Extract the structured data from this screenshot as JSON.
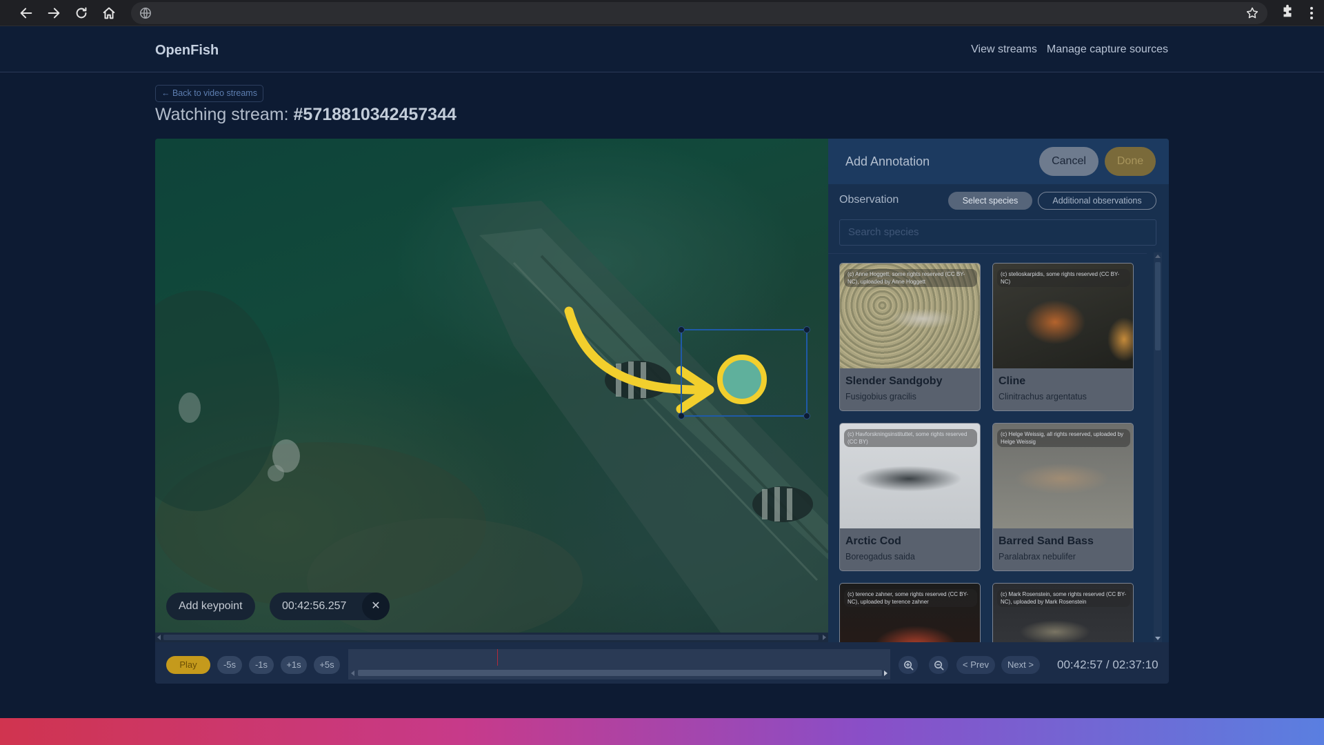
{
  "app": {
    "brand": "OpenFish",
    "nav": [
      "View streams",
      "Manage capture sources"
    ],
    "back_link": "← Back to video streams",
    "title_prefix": "Watching stream: ",
    "stream_id": "#5718810342457344"
  },
  "video": {
    "add_keypoint": "Add keypoint",
    "keypoint_time": "00:42:56.257",
    "close_glyph": "✕"
  },
  "annotation": {
    "title": "Add Annotation",
    "cancel": "Cancel",
    "done": "Done",
    "observation_label": "Observation",
    "tab_select_species": "Select species",
    "tab_additional": "Additional observations",
    "search_placeholder": "Search species",
    "species": [
      {
        "name": "Slender Sandgoby",
        "scientific": "Fusigobius gracilis",
        "credit": "(c) Anne Hoggett, some rights reserved (CC BY-NC), uploaded by Anne Hoggett"
      },
      {
        "name": "Cline",
        "scientific": "Clinitrachus argentatus",
        "credit": "(c) stelioskarpidis, some rights reserved (CC BY-NC)"
      },
      {
        "name": "Arctic Cod",
        "scientific": "Boreogadus saida",
        "credit": "(c) Havforskningsinstituttet, some rights reserved (CC BY)"
      },
      {
        "name": "Barred Sand Bass",
        "scientific": "Paralabrax nebulifer",
        "credit": "(c) Helge Weissig, all rights reserved, uploaded by Helge Weissig"
      },
      {
        "name": "",
        "scientific": "",
        "credit": "(c) terence zahner, some rights reserved (CC BY-NC), uploaded by terence zahner"
      },
      {
        "name": "",
        "scientific": "",
        "credit": "(c) Mark Rosenstein, some rights reserved (CC BY-NC), uploaded by Mark Rosenstein"
      }
    ]
  },
  "controls": {
    "play": "Play",
    "skip": [
      "-5s",
      "-1s",
      "+1s",
      "+5s"
    ],
    "prev": "< Prev",
    "next": "Next >",
    "time": "00:42:57 / 02:37:10"
  },
  "colors": {
    "accent": "#c59a1c",
    "highlight": "#f2cf2d",
    "bbox": "#1f5aa8"
  }
}
